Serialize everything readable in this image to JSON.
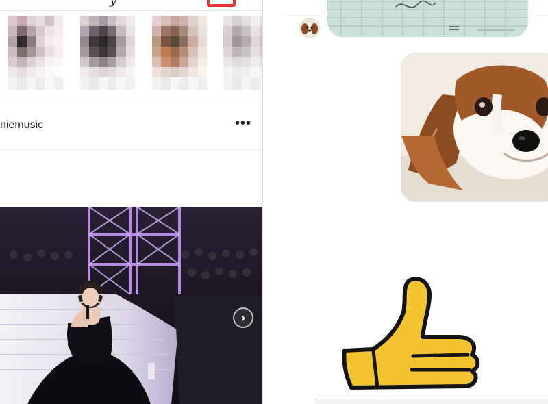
{
  "feed": {
    "logo_fragment": "y",
    "post": {
      "username": "niemusic",
      "more_label": "•••",
      "next_label": "›"
    },
    "stories": [
      {
        "palette": [
          "#d8c9cf",
          "#c7aab4",
          "#ddd0d6",
          "#e7dde1",
          "#cfc1c7",
          "#f0eaec",
          "#c8b7bd",
          "#7f6c71",
          "#b9a0a8",
          "#dac9cf",
          "#ede3e6",
          "#f3eef0",
          "#b5a3a6",
          "#2e2a2b",
          "#8d7b80",
          "#e0d1d6",
          "#f2eaec",
          "#f7f2f4",
          "#cbbdc1",
          "#7c6d70",
          "#a89598",
          "#cfc0c4",
          "#e9e0e2",
          "#f4eef0",
          "#d9ccd0",
          "#c3b3b7",
          "#ddd0d3",
          "#ece2e5",
          "#f6f1f3",
          "#faf6f7",
          "#efe8ea",
          "#e6dde0",
          "#f1ebed",
          "#f6f2f3",
          "#fbf8f9",
          "#fdfbfc"
        ]
      },
      {
        "palette": [
          "#d7d0d4",
          "#bfb3ba",
          "#a89aa2",
          "#c9bdc4",
          "#e2d9de",
          "#eee9ec",
          "#b4a6ae",
          "#6d6068",
          "#504449",
          "#786a71",
          "#c6bac0",
          "#e8e1e5",
          "#968891",
          "#3f383c",
          "#2e292c",
          "#4b4347",
          "#a6999f",
          "#ddd4d8",
          "#a6999f",
          "#5a5055",
          "#3d363a",
          "#585055",
          "#b5a9ae",
          "#e3dbdf",
          "#cfc5ca",
          "#a69aa0",
          "#8e8288",
          "#a99da3",
          "#d6ccd1",
          "#eee8eb",
          "#f0ebee",
          "#e4dde1",
          "#dcd4d8",
          "#e2dbdf",
          "#efe9ec",
          "#f7f3f5"
        ]
      },
      {
        "palette": [
          "#e4d3d2",
          "#d8bdb7",
          "#c9a79e",
          "#ccb3ab",
          "#e2d2cd",
          "#f1e8e6",
          "#cdb3a8",
          "#9b7565",
          "#8a6555",
          "#a58a7d",
          "#d6c3bb",
          "#ece1de",
          "#b89683",
          "#7a5444",
          "#5b4a3e",
          "#8b6e5e",
          "#c8ada0",
          "#e7d9d4",
          "#c9a28a",
          "#c27a4d",
          "#9c6b4f",
          "#b58d77",
          "#d7c1b6",
          "#efe3de",
          "#d9c3b8",
          "#c98f6c",
          "#b27d62",
          "#c7a897",
          "#e3d3cb",
          "#f5ede9",
          "#ebe0db",
          "#e4d4cc",
          "#dccbc2",
          "#e3d6cf",
          "#f0e7e3",
          "#f8f3f1"
        ]
      },
      {
        "palette": [
          "#e9e4e6",
          "#d9d1d4",
          "#e4dfe1",
          "#f2eff0",
          "#e6e1e3",
          "#d7d0d3",
          "#d9d2d5",
          "#b3aaae",
          "#c8c1c4",
          "#e6e1e3",
          "#d6cfd2",
          "#cbc4c7",
          "#d3cbce",
          "#9f979a",
          "#b5adb1",
          "#ddd7d9",
          "#cdc5c8",
          "#c2babd",
          "#dcd6d8",
          "#bdb5b8",
          "#c9c2c5",
          "#e4dfe1",
          "#d5cfd1",
          "#cec7ca",
          "#ebe7e8",
          "#e0dbdd",
          "#e3dee0",
          "#efeced",
          "#e7e3e4",
          "#e2dddf",
          "#f4f2f3",
          "#efeced",
          "#f1eeef",
          "#f7f5f6",
          "#f2f0f1",
          "#f0edee"
        ]
      }
    ],
    "story_name_palette": [
      "#f2f2f2",
      "#e9e9e9",
      "#f5f5f5",
      "#ececec",
      "#f7f7f7",
      "#efefef"
    ]
  },
  "chat": {
    "sticker": "thumbs-up",
    "colors": {
      "thumb_fill": "#f4c430",
      "thumb_outline": "#141414",
      "bubble_border": "#e3e3e3"
    }
  },
  "annotation": {
    "highlight_color": "#e8323a"
  }
}
